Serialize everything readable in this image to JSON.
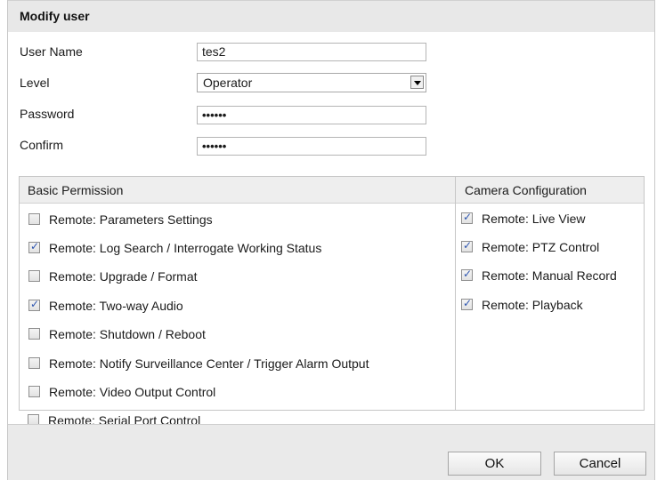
{
  "dialog": {
    "title": "Modify user"
  },
  "form": {
    "username_label": "User Name",
    "username_value": "tes2",
    "level_label": "Level",
    "level_value": "Operator",
    "password_label": "Password",
    "password_value": "••••••",
    "confirm_label": "Confirm",
    "confirm_value": "••••••"
  },
  "permissions": {
    "basic_header": "Basic Permission",
    "camera_header": "Camera Configuration",
    "basic": [
      {
        "label": "Remote: Parameters Settings",
        "checked": false
      },
      {
        "label": "Remote: Log Search / Interrogate Working Status",
        "checked": true
      },
      {
        "label": "Remote: Upgrade / Format",
        "checked": false
      },
      {
        "label": "Remote: Two-way Audio",
        "checked": true
      },
      {
        "label": "Remote: Shutdown / Reboot",
        "checked": false
      },
      {
        "label": "Remote: Notify Surveillance Center / Trigger Alarm Output",
        "checked": false
      },
      {
        "label": "Remote: Video Output Control",
        "checked": false
      },
      {
        "label": "Remote: Serial Port Control",
        "checked": false
      }
    ],
    "camera": [
      {
        "label": "Remote: Live View",
        "checked": true
      },
      {
        "label": "Remote: PTZ Control",
        "checked": true
      },
      {
        "label": "Remote: Manual Record",
        "checked": true
      },
      {
        "label": "Remote: Playback",
        "checked": true
      }
    ]
  },
  "footer": {
    "ok_label": "OK",
    "cancel_label": "Cancel"
  }
}
